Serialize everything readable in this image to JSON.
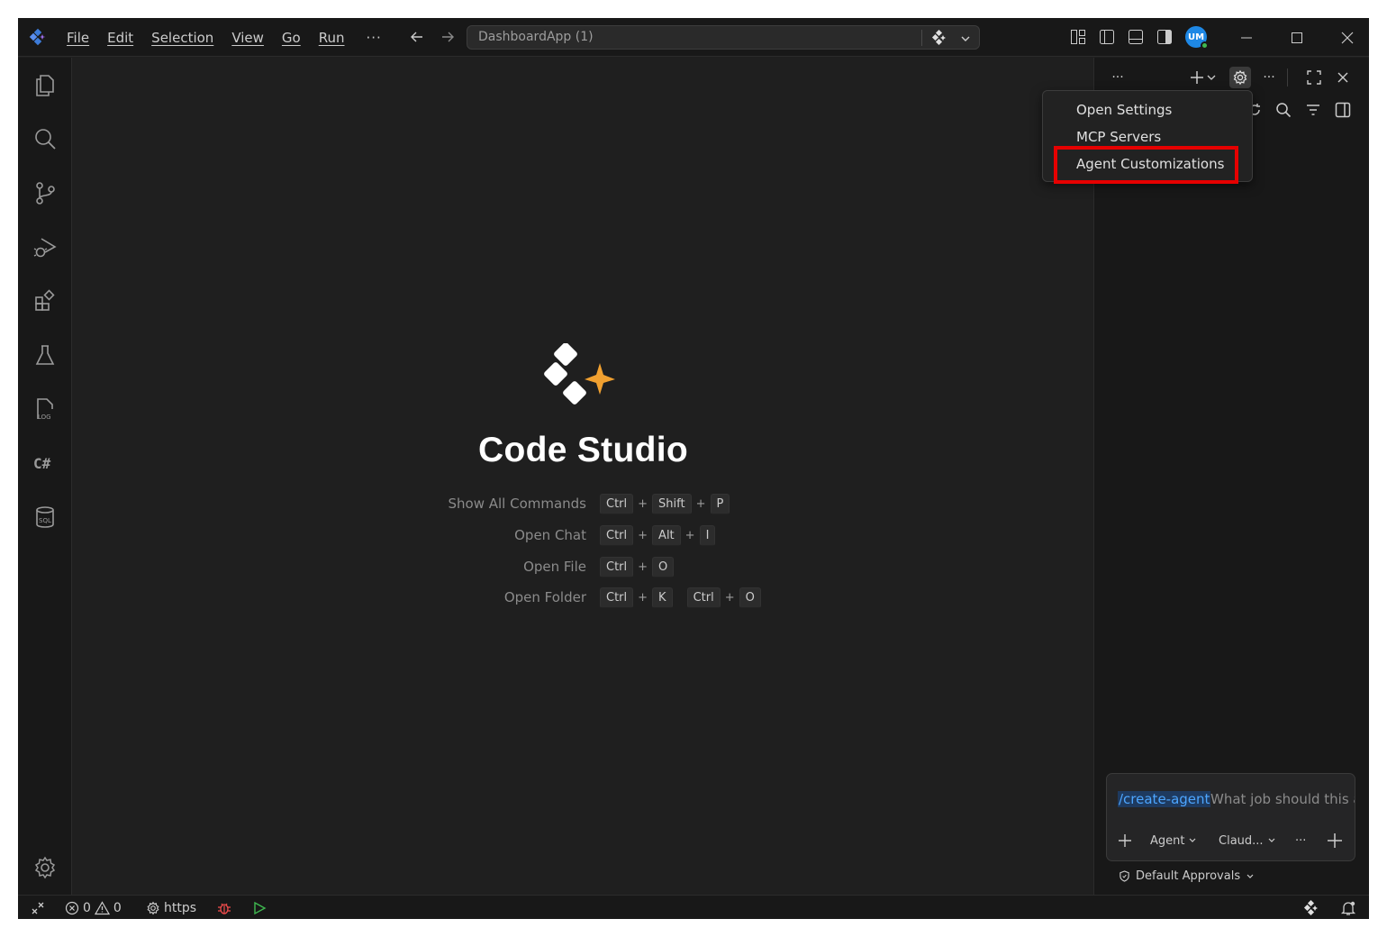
{
  "app": {
    "window_title": "DashboardApp (1)"
  },
  "menu": {
    "items": [
      "File",
      "Edit",
      "Selection",
      "View",
      "Go",
      "Run"
    ],
    "more": "···"
  },
  "welcome": {
    "title": "Code Studio",
    "shortcuts": [
      {
        "label": "Show All Commands",
        "keys": [
          [
            "Ctrl",
            "Shift",
            "P"
          ]
        ]
      },
      {
        "label": "Open Chat",
        "keys": [
          [
            "Ctrl",
            "Alt",
            "I"
          ]
        ]
      },
      {
        "label": "Open File",
        "keys": [
          [
            "Ctrl",
            "O"
          ]
        ]
      },
      {
        "label": "Open Folder",
        "keys": [
          [
            "Ctrl",
            "K"
          ],
          [
            "Ctrl",
            "O"
          ]
        ]
      }
    ]
  },
  "user": {
    "initials": "UM"
  },
  "aux": {
    "more": "···",
    "more2": "···"
  },
  "settings_menu": {
    "items": [
      "Open Settings",
      "MCP Servers",
      "Agent Customizations"
    ],
    "highlighted": "Agent Customizations"
  },
  "chat": {
    "command": "/create-agent",
    "placeholder": "What job should this a",
    "mode": "Agent",
    "model": "Claud...",
    "more": "···",
    "approvals": "Default Approvals"
  },
  "statusbar": {
    "errors": "0",
    "warnings": "0",
    "port": "https"
  },
  "colors": {
    "accent": "#1e88e5",
    "highlight": "#e60000",
    "sparkle": "#f0a030",
    "debug": "#f14c4c",
    "run": "#3fb950"
  }
}
